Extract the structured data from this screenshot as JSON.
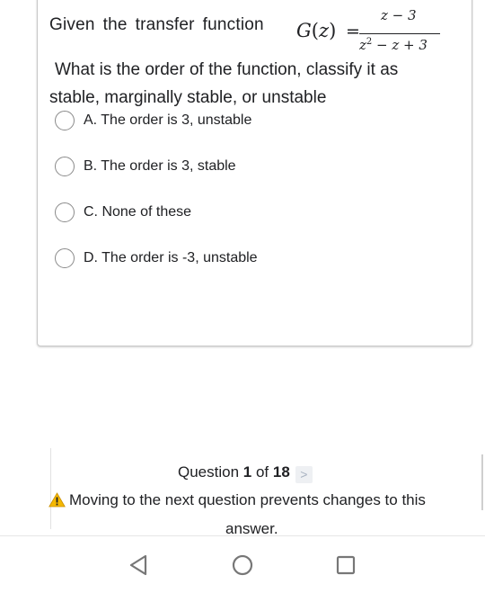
{
  "question": {
    "intro_words": [
      "Given",
      "the",
      "transfer",
      "function"
    ],
    "formula": {
      "lhs_fn": "G",
      "lhs_var": "z",
      "equals": "=",
      "numerator": "z − 3",
      "denominator_base": "z",
      "denominator_exp": "2",
      "denominator_rest": " − z + 3"
    },
    "body_line1": "What is the order of the function, classify it as",
    "body_line2": "stable, marginally stable, or unstable"
  },
  "options": [
    {
      "label": "A. The order is 3, unstable",
      "selected": false
    },
    {
      "label": "B. The order is 3, stable",
      "selected": false
    },
    {
      "label": "C. None of these",
      "selected": false
    },
    {
      "label": "D. The order is -3, unstable",
      "selected": false
    }
  ],
  "footer": {
    "question_prefix": "Question ",
    "question_current": "1",
    "question_of": " of ",
    "question_total": "18",
    "next_symbol": ">",
    "warning_line1": "Moving to the next question prevents changes to this",
    "warning_line2": "answer.",
    "warning_icon_color": "#f5b800"
  },
  "navbar": {
    "icons": [
      "back-triangle-icon",
      "home-circle-icon",
      "recents-square-icon"
    ]
  }
}
